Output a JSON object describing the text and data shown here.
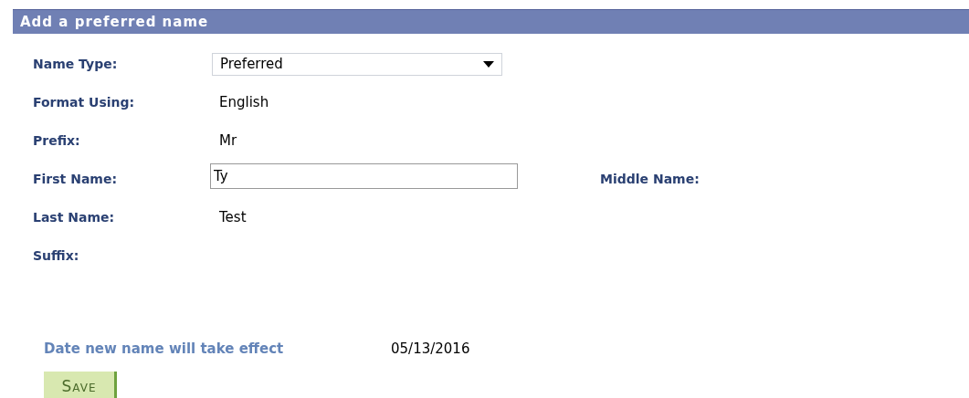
{
  "section_title": "Add a preferred name",
  "fields": [
    {
      "label": "Name Type:",
      "kind": "select",
      "value": "Preferred"
    },
    {
      "label": "Format Using:",
      "kind": "text",
      "value": "English"
    },
    {
      "label": "Prefix:",
      "kind": "text",
      "value": "Mr"
    },
    {
      "label": "First Name:",
      "kind": "input",
      "value": "Ty",
      "side_label": "Middle Name:"
    },
    {
      "label": "Last Name:",
      "kind": "text",
      "value": "Test"
    },
    {
      "label": "Suffix:",
      "kind": "empty"
    }
  ],
  "effective_date": {
    "label": "Date new name will take effect",
    "value": "05/13/2016"
  },
  "save_button": "Save"
}
